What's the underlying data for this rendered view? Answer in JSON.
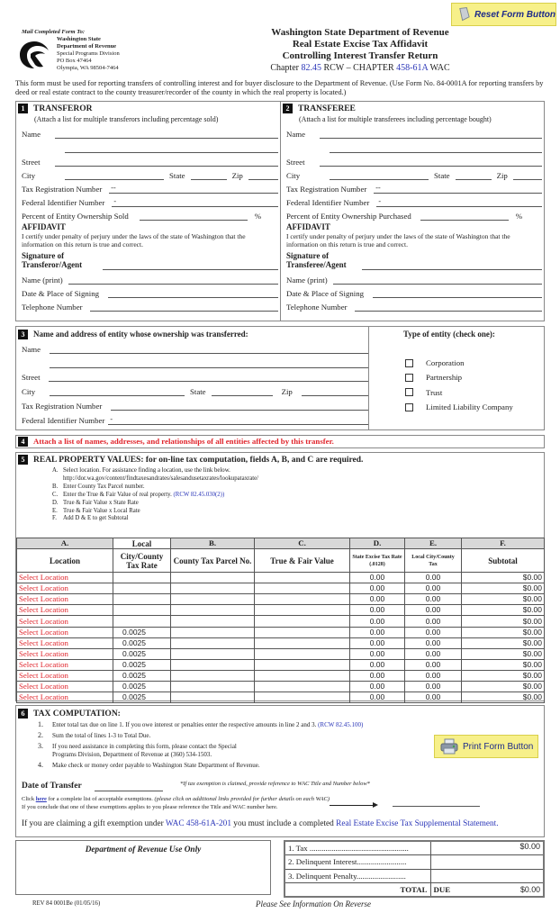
{
  "header": {
    "mail_label": "Mail Completed Form To:",
    "address": {
      "line1": "Washington State",
      "line2": "Department of Revenue",
      "line3": "Special Programs Division",
      "line4": "PO Box 47464",
      "line5": "Olympia, WA 98504-7464"
    },
    "title1": "Washington State Department of Revenue",
    "title2": "Real Estate Excise Tax Affidavit",
    "title3": "Controlling Interest Transfer Return",
    "chapter_prefix": "Chapter ",
    "chapter_rcw": "82.45",
    "chapter_mid": " RCW – CHAPTER ",
    "chapter_wac": "458-61A",
    "chapter_suffix": " WAC",
    "reset_button": "Reset Form Button",
    "intro": "This form must be used for reporting transfers of controlling interest and for buyer disclosure to the Department of Revenue. (Use Form No. 84-0001A for reporting transfers by deed or real estate contract to the county treasurer/recorder of the county in which the real property is located.)"
  },
  "section1": {
    "num": "1",
    "title": "TRANSFEROR",
    "subtitle": "(Attach a list for multiple transferors including percentage sold)",
    "name": "Name",
    "street": "Street",
    "city": "City",
    "state": "State",
    "zip": "Zip",
    "tax_reg": "Tax Registration Number",
    "tax_reg_value": "--",
    "fed_id": "Federal Identifier Number",
    "fed_id_value": "-",
    "percent": "Percent of Entity Ownership Sold",
    "pct_sign": "%",
    "affidavit": "AFFIDAVIT",
    "affidavit_text": "I certify under penalty of perjury under the laws of the state of Washington that the information on this return is true and correct.",
    "sig1": "Signature of",
    "sig2": "Transferor/Agent",
    "name_print": "Name (print)",
    "date_place": "Date & Place of Signing",
    "phone": "Telephone Number"
  },
  "section2": {
    "num": "2",
    "title": "TRANSFEREE",
    "subtitle": "(Attach a list for multiple transferees including percentage bought)",
    "name": "Name",
    "street": "Street",
    "city": "City",
    "state": "State",
    "zip": "Zip",
    "tax_reg": "Tax Registration Number",
    "tax_reg_value": "--",
    "fed_id": "Federal Identifier Number",
    "fed_id_value": "-",
    "percent": "Percent of Entity Ownership Purchased",
    "pct_sign": "%",
    "affidavit": "AFFIDAVIT",
    "affidavit_text": "I certify under penalty of perjury under the laws of the state of Washington that the information on this return is true and correct.",
    "sig1": "Signature of",
    "sig2": "Transferee/Agent",
    "name_print": "Name (print)",
    "date_place": "Date & Place of Signing",
    "phone": "Telephone Number"
  },
  "section3": {
    "num": "3",
    "title": "Name and address of entity whose ownership was transferred:",
    "name": "Name",
    "street": "Street",
    "city": "City",
    "state": "State",
    "zip": "Zip",
    "tax_reg": "Tax Registration Number",
    "fed_id": "Federal Identifier Number",
    "fed_id_value": "-",
    "entity_title": "Type of entity (check one):",
    "entity_types": [
      "Corporation",
      "Partnership",
      "Trust",
      "Limited Liability Company"
    ]
  },
  "section4": {
    "num": "4",
    "text": "Attach a list of names, addresses, and relationships of all entities affected by this transfer."
  },
  "section5": {
    "num": "5",
    "title": "REAL PROPERTY VALUES: for on-line tax computation, fields A, B, and C are required.",
    "steps": [
      {
        "k": "A.",
        "t": "Select location.  For assistance finding a location, use the link below."
      },
      {
        "k": "",
        "t": "http://dor.wa.gov/content/findtaxesandrates/salesandusetaxrates/lookupataxrate/"
      },
      {
        "k": "B.",
        "t": "Enter County Tax Parcel number."
      },
      {
        "k": "C.",
        "t": "Enter the True & Fair Value of real property.  ",
        "link": "(RCW 82.45.030(2))"
      },
      {
        "k": "D.",
        "t": "True & Fair Value x State Rate"
      },
      {
        "k": "E.",
        "t": "True & Fair Value x Local Rate"
      },
      {
        "k": "F.",
        "t": "Add D & E to get Subtotal"
      }
    ],
    "table": {
      "letters": [
        "A.",
        "Local",
        "B.",
        "C.",
        "D.",
        "E.",
        "F."
      ],
      "headers": [
        "Location",
        "City/County Tax Rate",
        "County Tax Parcel No.",
        "True & Fair Value",
        "State Excise Tax Rate (.0128)",
        "Local City/County Tax",
        "Subtotal"
      ],
      "rows": [
        {
          "location": "Select Location",
          "rate": "",
          "parcel": "",
          "value": "",
          "state_tax": "0.00",
          "local_tax": "0.00",
          "subtotal": "$0.00"
        },
        {
          "location": "Select Location",
          "rate": "",
          "parcel": "",
          "value": "",
          "state_tax": "0.00",
          "local_tax": "0.00",
          "subtotal": "$0.00"
        },
        {
          "location": "Select Location",
          "rate": "",
          "parcel": "",
          "value": "",
          "state_tax": "0.00",
          "local_tax": "0.00",
          "subtotal": "$0.00"
        },
        {
          "location": "Select Location",
          "rate": "",
          "parcel": "",
          "value": "",
          "state_tax": "0.00",
          "local_tax": "0.00",
          "subtotal": "$0.00"
        },
        {
          "location": "Select Location",
          "rate": "",
          "parcel": "",
          "value": "",
          "state_tax": "0.00",
          "local_tax": "0.00",
          "subtotal": "$0.00"
        },
        {
          "location": "Select Location",
          "rate": "0.0025",
          "parcel": "",
          "value": "",
          "state_tax": "0.00",
          "local_tax": "0.00",
          "subtotal": "$0.00"
        },
        {
          "location": "Select Location",
          "rate": "0.0025",
          "parcel": "",
          "value": "",
          "state_tax": "0.00",
          "local_tax": "0.00",
          "subtotal": "$0.00"
        },
        {
          "location": "Select Location",
          "rate": "0.0025",
          "parcel": "",
          "value": "",
          "state_tax": "0.00",
          "local_tax": "0.00",
          "subtotal": "$0.00"
        },
        {
          "location": "Select Location",
          "rate": "0.0025",
          "parcel": "",
          "value": "",
          "state_tax": "0.00",
          "local_tax": "0.00",
          "subtotal": "$0.00"
        },
        {
          "location": "Select Location",
          "rate": "0.0025",
          "parcel": "",
          "value": "",
          "state_tax": "0.00",
          "local_tax": "0.00",
          "subtotal": "$0.00"
        },
        {
          "location": "Select Location",
          "rate": "0.0025",
          "parcel": "",
          "value": "",
          "state_tax": "0.00",
          "local_tax": "0.00",
          "subtotal": "$0.00"
        },
        {
          "location": "Select Location",
          "rate": "0.0025",
          "parcel": "",
          "value": "",
          "state_tax": "0.00",
          "local_tax": "0.00",
          "subtotal": "$0.00"
        }
      ]
    }
  },
  "section6": {
    "num": "6",
    "title": "TAX COMPUTATION:",
    "steps": [
      {
        "k": "1.",
        "t": "Enter total tax due on line 1. If you owe interest or penalties enter the respective amounts in line 2 and 3. ",
        "link": "(RCW 82.45.100)"
      },
      {
        "k": "2.",
        "t": "Sum the total of lines 1-3 to Total Due."
      },
      {
        "k": "3.",
        "t": "If you need assistance in completing this form, please contact the Special Programs Division, Department of Revenue at (360) 534-1503."
      },
      {
        "k": "4.",
        "t": "Make check or money order payable to Washington State Department of Revenue."
      }
    ],
    "print_button": "Print Form Button",
    "date_transfer": "Date of Transfer",
    "exemption_note": "*If tax exemption is claimed, provide reference to WAC Title and Number below*",
    "click": "Click ",
    "here": "here",
    "click_rest": " for a complete list of acceptable exemptions. ",
    "click_italic": "(please click on additional links provided for further details on each WAC)",
    "conclude": "If you conclude that one of these exemptions applies to you please reference the Title and WAC number here.",
    "gift_prefix": "If you are claiming a gift exemption under ",
    "gift_wac": "WAC 458-61A-201",
    "gift_mid": " you must include a completed ",
    "gift_link": "Real Estate Excise Tax Supplemental Statement."
  },
  "footer": {
    "dor_use": "Department of Revenue Use Only",
    "totals": [
      {
        "label": "1. Tax ..................................................",
        "amount": "$0.00"
      },
      {
        "label": "2. Delinquent Interest.........................",
        "amount": ""
      },
      {
        "label": "3. Delinquent Penalty.........................",
        "amount": ""
      }
    ],
    "total_label": "TOTAL",
    "due_label": "DUE",
    "total_amount": "$0.00",
    "rev": "REV 84 0001Be (01/05/16)",
    "reverse": "Please See Information On Reverse"
  }
}
